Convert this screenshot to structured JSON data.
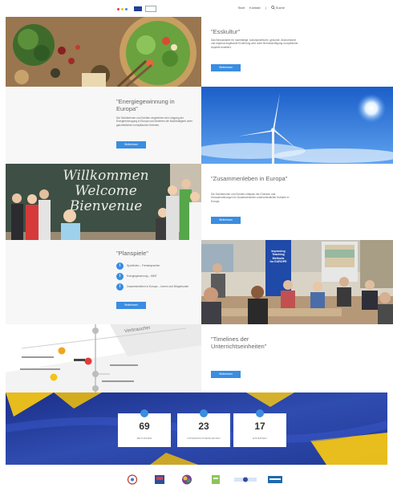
{
  "header": {
    "logo_text": "",
    "nav": [
      "Start",
      "Kontakt"
    ],
    "search_label": "Suche"
  },
  "sections": {
    "esskultur": {
      "title": "\"Esskultur\"",
      "text": "Das Bewusstsein für nachhaltige, kulturspezifische, gesunde, ökonomische und regional angebaute Ernährung wird unter Berücksichtigung europäischer Aspekte erweitert.",
      "button": "Weiterlesen"
    },
    "energie": {
      "title": "\"Energiegewinnung in Europa\"",
      "text": "Die Schülerinnen und Schüler vergleichen den Umgang der Energieerzeugung in Europa und bewerten die Nachhaltigkeit unter ganzheitlichen europäischen Kriterien.",
      "button": "Weiterlesen"
    },
    "zusammenleben": {
      "title": "\"Zusammenleben in Europa\"",
      "text": "Die Schülerinnen und Schüler erfassen die Chancen und Herausforderungen im Zusammenleben unterschiedlicher Kulturen in Europa.",
      "button": "Weiterlesen"
    },
    "planspiele": {
      "title": "\"Planspiele\"",
      "items": [
        "Spurfinden – Fremdsprachen",
        "Energiegewinnung – MINT",
        "Zusammenleben in Europa – Lernen und Bürgerkunde"
      ],
      "button": "Weiterlesen"
    },
    "timelines": {
      "title": "\"Timelines der Unterrichtseinheiten\"",
      "button": "Weiterlesen"
    }
  },
  "images": {
    "classroom_board": "Willkommen Welcome Bienvenue",
    "banner": [
      "Improving",
      "Teaching",
      "Methods",
      "for EUROPE"
    ],
    "timeline_fragment": "Verbraucher"
  },
  "stats": [
    {
      "value": "69",
      "label": "METHODEN"
    },
    {
      "value": "23",
      "label": "UNTERRICHTSEINHEITEN"
    },
    {
      "value": "17",
      "label": "EXPERTEN"
    }
  ],
  "colors": {
    "accent": "#3a8de0",
    "eu_blue": "#2a3f9e",
    "eu_yellow": "#f2c417"
  }
}
